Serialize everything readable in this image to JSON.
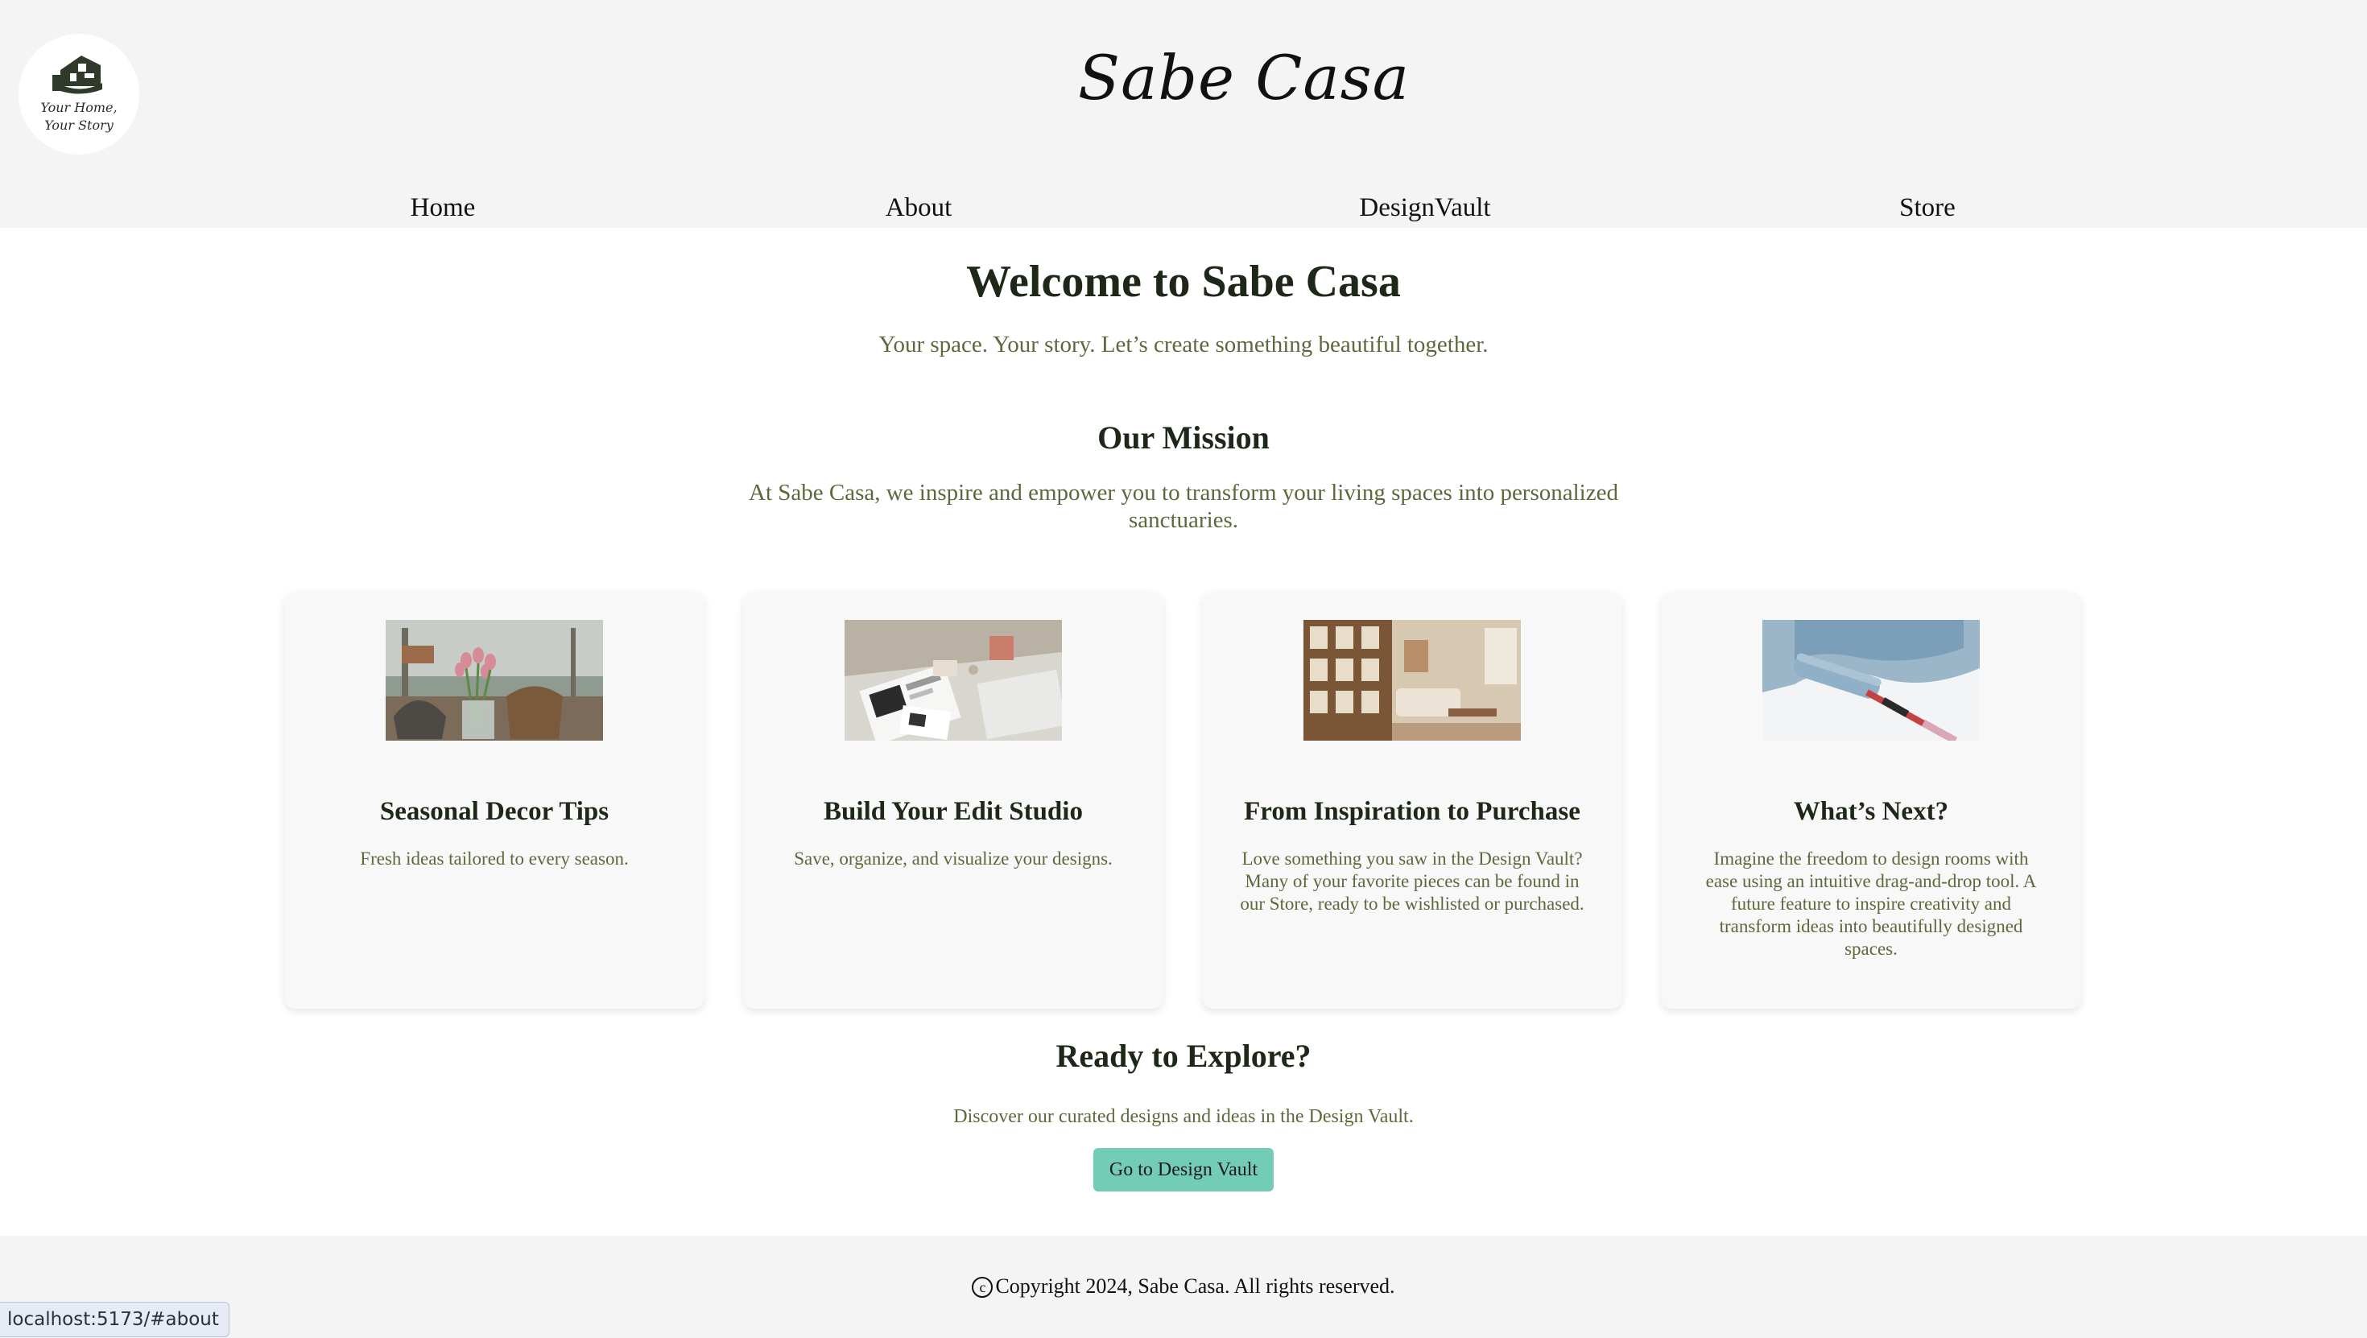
{
  "header": {
    "logo_line1": "Your Home,",
    "logo_line2": "Your Story",
    "brand": "Sabe Casa"
  },
  "nav": [
    {
      "label": "Home"
    },
    {
      "label": "About"
    },
    {
      "label": "DesignVault"
    },
    {
      "label": "Store"
    }
  ],
  "hero": {
    "title": "Welcome to Sabe Casa",
    "subtitle": "Your space. Your story. Let’s create something beautiful together."
  },
  "mission": {
    "title": "Our Mission",
    "text": "At Sabe Casa, we inspire and empower you to transform your living spaces into personalized sanctuaries."
  },
  "cards": [
    {
      "title": "Seasonal Decor Tips",
      "text": "Fresh ideas tailored to every season."
    },
    {
      "title": "Build Your Edit Studio",
      "text": "Save, organize, and visualize your designs."
    },
    {
      "title": "From Inspiration to Purchase",
      "text": "Love something you saw in the Design Vault? Many of your favorite pieces can be found in our Store, ready to be wishlisted or purchased."
    },
    {
      "title": "What’s Next?",
      "text": "Imagine the freedom to design rooms with ease using an intuitive drag-and-drop tool. A future feature to inspire creativity and transform ideas into beautifully designed spaces."
    }
  ],
  "explore": {
    "title": "Ready to Explore?",
    "text": "Discover our curated designs and ideas in the Design Vault.",
    "button": "Go to Design Vault"
  },
  "footer": {
    "copyright_symbol": "c",
    "text": "Copyright 2024, Sabe Casa. All rights reserved."
  },
  "status_bar": {
    "url": "localhost:5173/#about"
  },
  "colors": {
    "accent": "#73cdb6",
    "header_bg": "#f4f4f4",
    "heading": "#1d2818",
    "body_text": "#5b6a3c"
  }
}
